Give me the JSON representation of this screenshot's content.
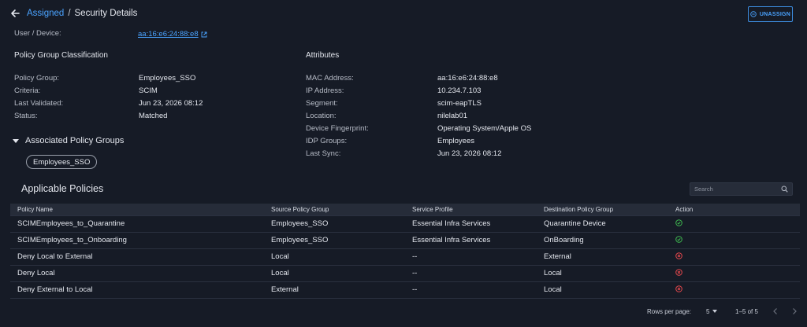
{
  "breadcrumb": {
    "parent": "Assigned",
    "separator": "/",
    "current": "Security Details"
  },
  "actions": {
    "unassign_label": "UNASSIGN"
  },
  "user_device": {
    "label": "User / Device:",
    "value": "aa:16:e6:24:88:e8"
  },
  "classification": {
    "title": "Policy Group Classification",
    "fields": [
      {
        "label": "Policy Group:",
        "value": "Employees_SSO"
      },
      {
        "label": "Criteria:",
        "value": "SCIM"
      },
      {
        "label": "Last Validated:",
        "value": "Jun 23, 2026 08:12"
      },
      {
        "label": "Status:",
        "value": "Matched"
      }
    ]
  },
  "attributes": {
    "title": "Attributes",
    "fields": [
      {
        "label": "MAC Address:",
        "value": "aa:16:e6:24:88:e8"
      },
      {
        "label": "IP Address:",
        "value": "10.234.7.103"
      },
      {
        "label": "Segment:",
        "value": "scim-eapTLS"
      },
      {
        "label": "Location:",
        "value": "nilelab01"
      },
      {
        "label": "Device Fingerprint:",
        "value": "Operating System/Apple OS"
      },
      {
        "label": "IDP Groups:",
        "value": "Employees"
      },
      {
        "label": "Last Sync:",
        "value": "Jun 23, 2026 08:12"
      }
    ]
  },
  "associated": {
    "title": "Associated Policy Groups",
    "chips": [
      "Employees_SSO"
    ]
  },
  "policies": {
    "title": "Applicable Policies",
    "search_placeholder": "Search",
    "columns": [
      "Policy Name",
      "Source Policy Group",
      "Service Profile",
      "Destination Policy Group",
      "Action"
    ],
    "rows": [
      {
        "name": "SCIMEmployees_to_Quarantine",
        "source": "Employees_SSO",
        "service": "Essential Infra Services",
        "destination": "Quarantine Device",
        "action": "allow"
      },
      {
        "name": "SCIMEmployees_to_Onboarding",
        "source": "Employees_SSO",
        "service": "Essential Infra Services",
        "destination": "OnBoarding",
        "action": "allow"
      },
      {
        "name": "Deny Local to External",
        "source": "Local",
        "service": "--",
        "destination": "External",
        "action": "deny"
      },
      {
        "name": "Deny Local",
        "source": "Local",
        "service": "--",
        "destination": "Local",
        "action": "deny"
      },
      {
        "name": "Deny External to Local",
        "source": "External",
        "service": "--",
        "destination": "Local",
        "action": "deny"
      }
    ]
  },
  "pagination": {
    "rows_per_page_label": "Rows per page:",
    "rows_per_page": "5",
    "range": "1–5 of 5"
  },
  "colors": {
    "accent": "#4aa3ff",
    "allow": "#3fb950",
    "deny": "#e5484d",
    "background": "#161b26"
  }
}
